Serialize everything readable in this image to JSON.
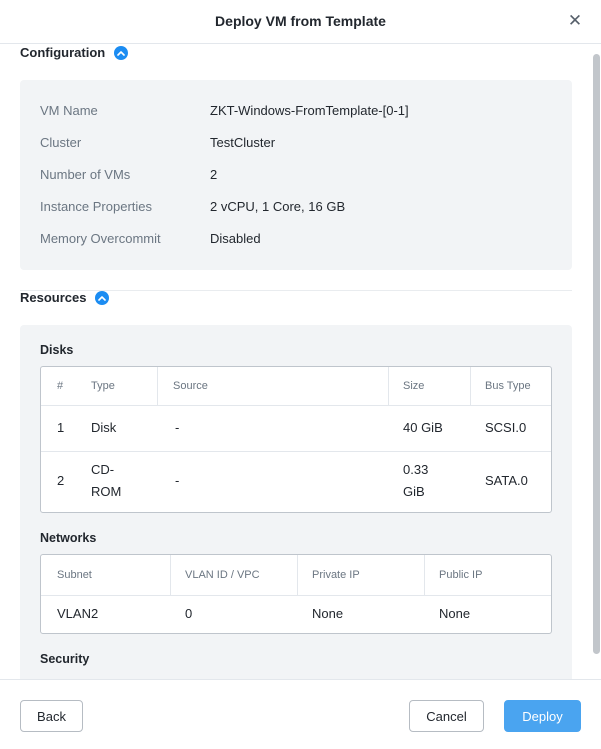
{
  "header": {
    "title": "Deploy VM from Template",
    "close_glyph": "✕"
  },
  "configuration": {
    "title": "Configuration",
    "rows": [
      {
        "label": "VM Name",
        "value": "ZKT-Windows-FromTemplate-[0-1]"
      },
      {
        "label": "Cluster",
        "value": "TestCluster"
      },
      {
        "label": "Number of VMs",
        "value": "2"
      },
      {
        "label": "Instance Properties",
        "value": "2 vCPU, 1 Core, 16 GB"
      },
      {
        "label": "Memory Overcommit",
        "value": "Disabled"
      }
    ]
  },
  "resources": {
    "title": "Resources",
    "disks": {
      "title": "Disks",
      "columns": [
        "#",
        "Type",
        "Source",
        "Size",
        "Bus Type"
      ],
      "rows": [
        {
          "num": "1",
          "type": "Disk",
          "source": "-",
          "size": "40 GiB",
          "bus": "SCSI.0"
        },
        {
          "num": "2",
          "type": "CD-\nROM",
          "source": "-",
          "size": "0.33\nGiB",
          "bus": "SATA.0"
        }
      ]
    },
    "networks": {
      "title": "Networks",
      "columns": [
        "Subnet",
        "VLAN ID / VPC",
        "Private IP",
        "Public IP"
      ],
      "rows": [
        {
          "subnet": "VLAN2",
          "vlan": "0",
          "private_ip": "None",
          "public_ip": "None"
        }
      ]
    },
    "security_title": "Security"
  },
  "footer": {
    "back_label": "Back",
    "cancel_label": "Cancel",
    "deploy_label": "Deploy"
  },
  "colors": {
    "primary": "#4aa4f0",
    "accent": "#1b8cf2",
    "panel_bg": "#f2f4f6"
  },
  "icons": {
    "close": "close-icon",
    "collapse": "chevron-up-icon"
  }
}
